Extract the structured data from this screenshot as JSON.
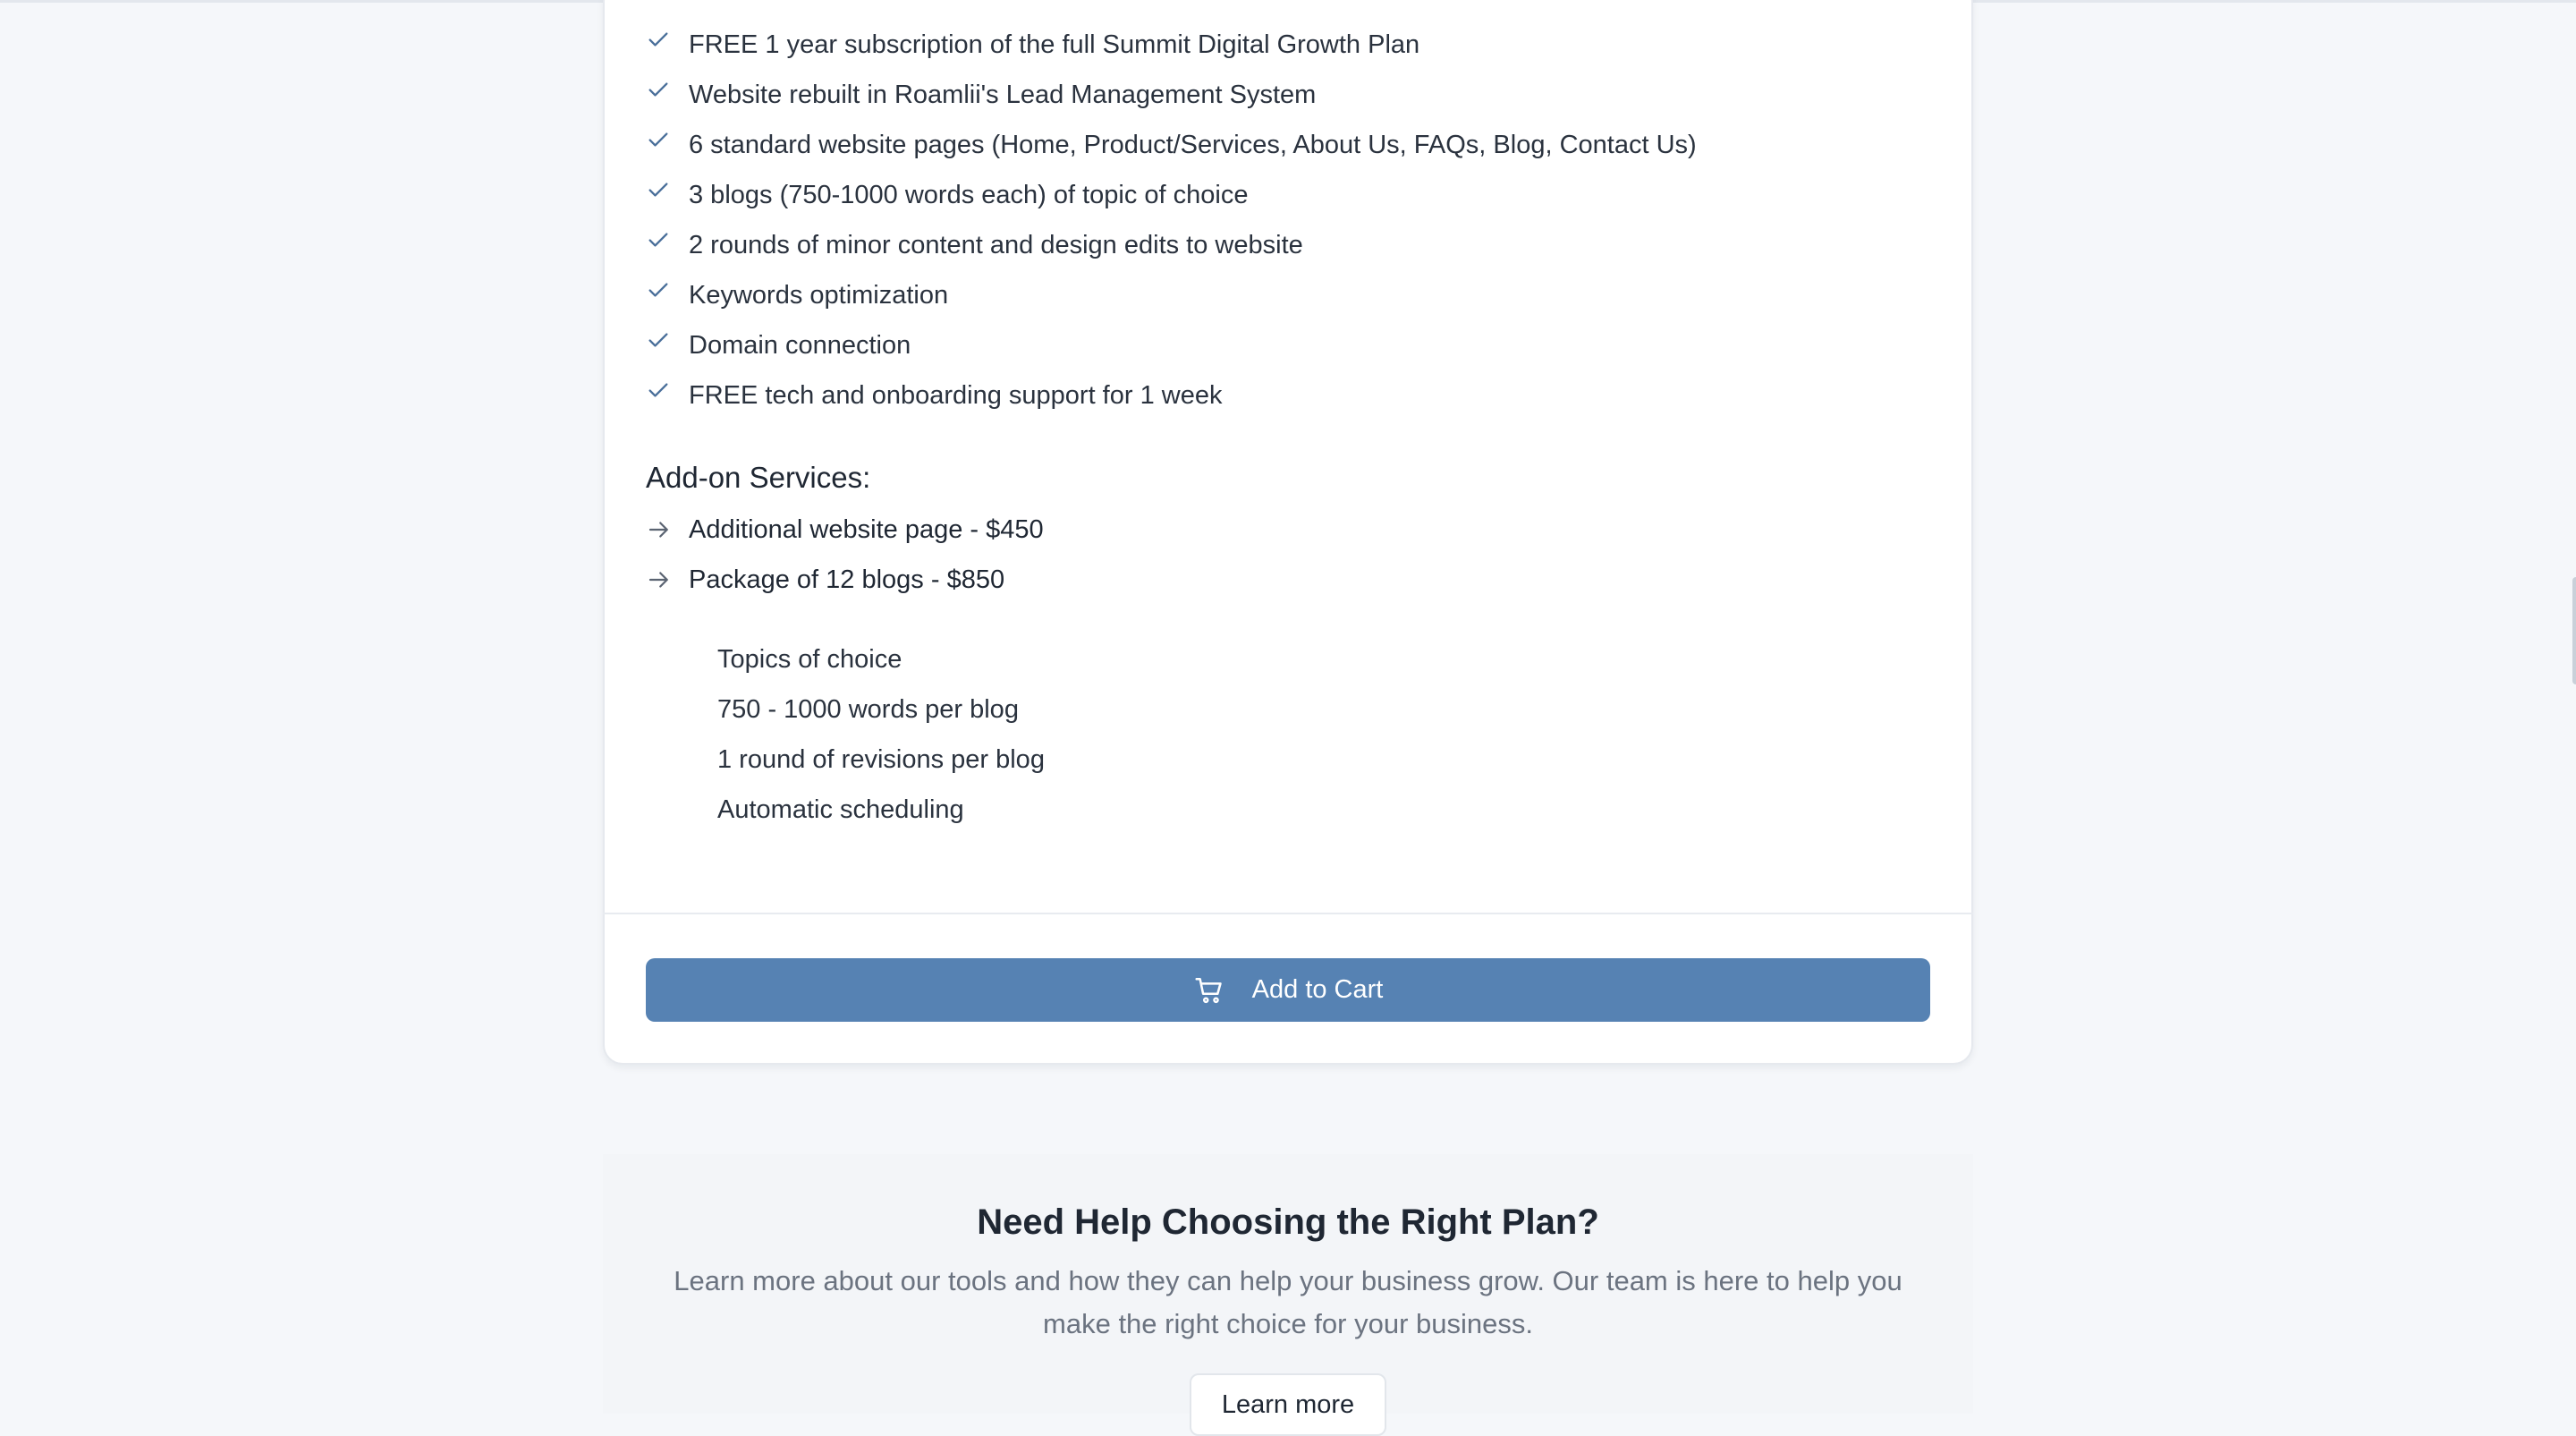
{
  "plan_features": [
    "FREE 1 year subscription of the full Summit Digital Growth Plan",
    "Website rebuilt in Roamlii's Lead Management System",
    "6 standard website pages (Home, Product/Services, About Us, FAQs, Blog, Contact Us)",
    "3 blogs (750-1000 words each) of topic of choice",
    "2 rounds of minor content and design edits to website",
    "Keywords optimization",
    "Domain connection",
    "FREE tech and onboarding support for 1 week"
  ],
  "addons": {
    "heading": "Add-on Services:",
    "items": [
      "Additional website page - $450",
      "Package of 12 blogs - $850"
    ],
    "blog_package_details": [
      "Topics of choice",
      "750 - 1000 words per blog",
      "1 round of revisions per blog",
      "Automatic scheduling"
    ]
  },
  "cart": {
    "button_label": "Add to Cart",
    "icon": "shopping-cart-icon"
  },
  "help": {
    "title": "Need Help Choosing the Right Plan?",
    "text": "Learn more about our tools and how they can help your business grow. Our team is here to help you make the right choice for your business.",
    "button_label": "Learn more"
  },
  "colors": {
    "accent": "#5682b3",
    "check": "#4a6f9a",
    "page_background": "#f5f7fa",
    "card_background": "#ffffff",
    "muted_text": "#6b7380"
  },
  "icons": {
    "feature_marker": "check-icon",
    "addon_marker": "arrow-right-icon"
  }
}
